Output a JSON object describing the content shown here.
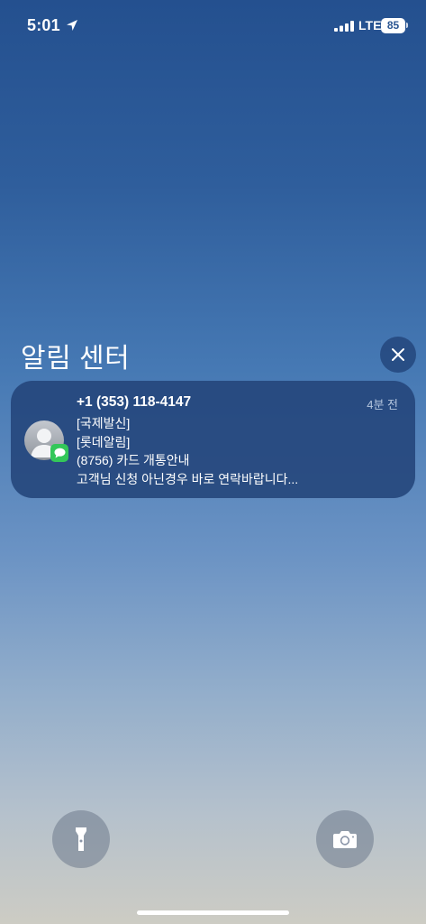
{
  "status_bar": {
    "time": "5:01",
    "network": "LTE",
    "battery": "85",
    "icons": [
      "location-arrow-icon",
      "signal-icon"
    ]
  },
  "notification_center": {
    "title": "알림 센터",
    "close_icon": "close-icon"
  },
  "notification": {
    "app_icon": "messages-icon",
    "sender": "+1 (353) 118-4147",
    "time_ago": "4분 전",
    "lines": [
      "[국제발신]",
      "[롯데알림]",
      "(8756) 카드 개통안내",
      "고객님 신청 아닌경우 바로 연락바랍니다..."
    ]
  },
  "quick_actions": {
    "flashlight_icon": "flashlight-icon",
    "camera_icon": "camera-icon"
  },
  "colors": {
    "card_background": "#23447a",
    "badge_green": "#34c759"
  }
}
